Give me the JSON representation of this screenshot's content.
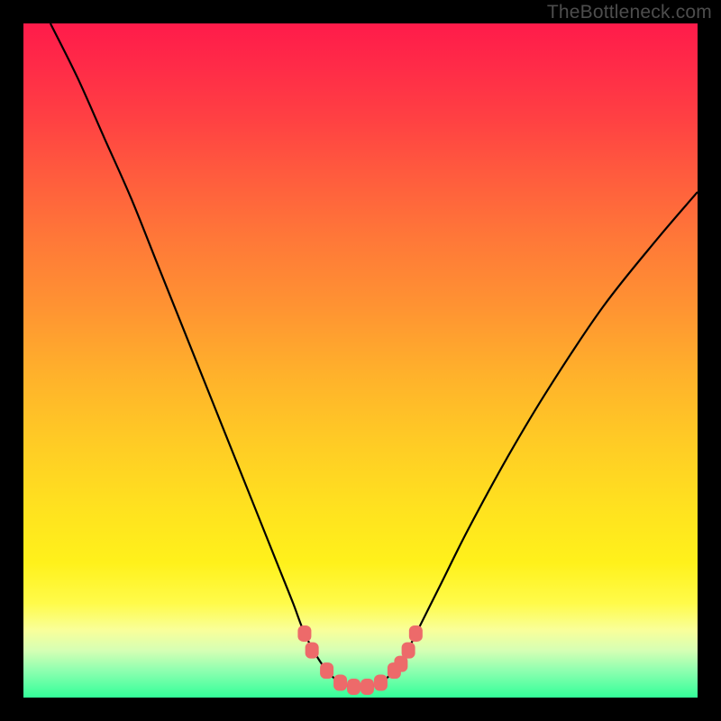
{
  "watermark": "TheBottleneck.com",
  "colors": {
    "frame": "#000000",
    "curve": "#000000",
    "marker": "#ed6a6a"
  },
  "chart_data": {
    "type": "line",
    "title": "",
    "xlabel": "",
    "ylabel": "",
    "xlim": [
      0,
      100
    ],
    "ylim": [
      0,
      100
    ],
    "x": [
      4,
      8,
      12,
      16,
      20,
      24,
      28,
      32,
      36,
      38,
      40,
      41.5,
      43,
      45,
      47,
      49,
      51,
      53,
      55,
      56.5,
      58,
      62,
      66,
      72,
      78,
      86,
      94,
      100
    ],
    "values": [
      100,
      92,
      83,
      74,
      64,
      54,
      44,
      34,
      24,
      19,
      14,
      10,
      7,
      4,
      2.2,
      1.6,
      1.6,
      2.2,
      4,
      6,
      9,
      17,
      25,
      36,
      46,
      58,
      68,
      75
    ],
    "markers_x": [
      41.7,
      42.8,
      45.0,
      47.0,
      49.0,
      51.0,
      53.0,
      55.0,
      56.0,
      57.1,
      58.2
    ],
    "markers_y": [
      9.5,
      7.0,
      4.0,
      2.2,
      1.6,
      1.6,
      2.2,
      4.0,
      5.0,
      7.0,
      9.5
    ]
  }
}
